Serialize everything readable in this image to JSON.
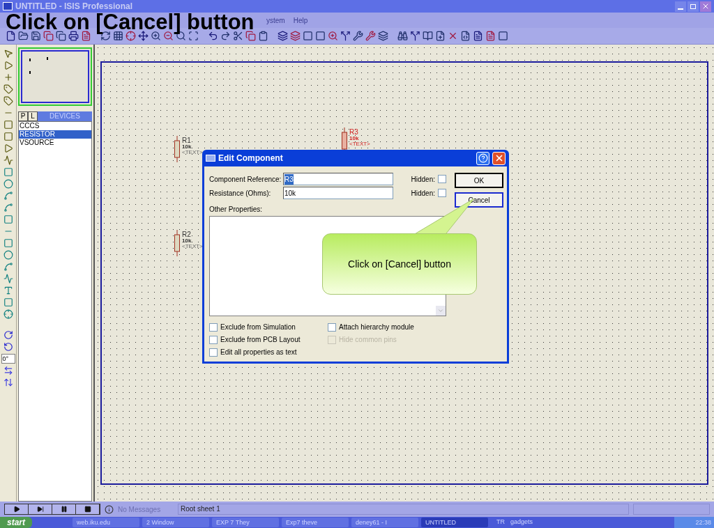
{
  "slide_heading": "Click on [Cancel] button",
  "window": {
    "title": "UNTITLED - ISIS Professional"
  },
  "menu": [
    "ystem",
    "Help"
  ],
  "object_selector": {
    "tabs": [
      {
        "label": "P",
        "selected": false
      },
      {
        "label": "L",
        "selected": false
      }
    ],
    "header": "DEVICES",
    "items": [
      {
        "label": "CCCS",
        "selected": false
      },
      {
        "label": "RESISTOR",
        "selected": true
      },
      {
        "label": "VSOURCE",
        "selected": false
      }
    ]
  },
  "rotation": "0°",
  "schematic": {
    "components": [
      {
        "ref": "R1",
        "value": "10k",
        "text": "<TEXT>",
        "selected": false
      },
      {
        "ref": "R2",
        "value": "10k",
        "text": "<TEXT>",
        "selected": false
      },
      {
        "ref": "R3",
        "value": "10k",
        "text": "<TEXT>",
        "selected": true
      }
    ]
  },
  "dialog": {
    "title": "Edit Component",
    "fields": [
      {
        "label": "Component Reference:",
        "value": "R3",
        "value_selected": true,
        "hidden_label": "Hidden:",
        "hidden": false
      },
      {
        "label": "Resistance (Ohms):",
        "value": "10k",
        "value_selected": false,
        "hidden_label": "Hidden:",
        "hidden": false
      }
    ],
    "other_properties_label": "Other Properties:",
    "checkboxes": [
      {
        "label": "Exclude from Simulation",
        "checked": false,
        "disabled": false
      },
      {
        "label": "Exclude from PCB Layout",
        "checked": false,
        "disabled": false
      },
      {
        "label": "Edit all properties as text",
        "checked": false,
        "disabled": false
      },
      {
        "label": "Attach hierarchy module",
        "checked": false,
        "disabled": false
      },
      {
        "label": "Hide common pins",
        "checked": false,
        "disabled": true
      }
    ],
    "buttons": [
      {
        "label": "OK",
        "focused": false
      },
      {
        "label": "Cancel",
        "focused": true
      }
    ]
  },
  "callout": "Click on [Cancel] button",
  "status_bar": {
    "message": "No Messages",
    "sheet": "Root sheet 1"
  },
  "taskbar": {
    "start": "start",
    "items": [
      {
        "label": "web.iku.edu",
        "active": false
      },
      {
        "label": "2 Window",
        "active": false
      },
      {
        "label": "EXP 7 They",
        "active": false
      },
      {
        "label": "Exp7 theve",
        "active": false
      },
      {
        "label": "deney61 - I",
        "active": false
      },
      {
        "label": "UNTITLED",
        "active": true
      }
    ],
    "language": "TR",
    "tray": "gadgets",
    "clock": "22:38"
  }
}
